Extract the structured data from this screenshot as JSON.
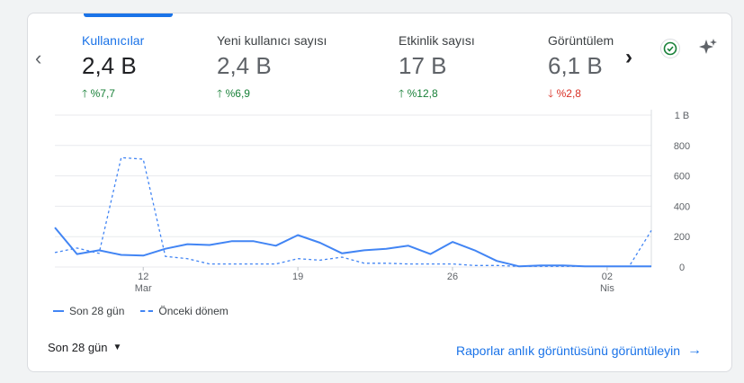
{
  "metrics": [
    {
      "label": "Kullanıcılar",
      "value": "2,4 B",
      "delta": "%7,7",
      "direction": "up",
      "active": true
    },
    {
      "label": "Yeni kullanıcı sayısı",
      "value": "2,4 B",
      "delta": "%6,9",
      "direction": "up",
      "active": false
    },
    {
      "label": "Etkinlik sayısı",
      "value": "17 B",
      "delta": "%12,8",
      "direction": "up",
      "active": false
    },
    {
      "label": "Görüntülem",
      "value": "6,1 B",
      "delta": "%2,8",
      "direction": "down",
      "active": false
    }
  ],
  "icons": {
    "prev": "chevron-left-icon",
    "next": "chevron-right-icon",
    "status": "check-circle-icon",
    "insights": "sparkle-icon"
  },
  "colors": {
    "accent": "#1a73e8",
    "series": "#4285f4",
    "up": "#188038",
    "down": "#d93025"
  },
  "chart_data": {
    "type": "line",
    "x_ticks": [
      {
        "label": "12",
        "sublabel": "Mar",
        "index": 4
      },
      {
        "label": "19",
        "sublabel": "",
        "index": 11
      },
      {
        "label": "26",
        "sublabel": "",
        "index": 18
      },
      {
        "label": "02",
        "sublabel": "Nis",
        "index": 25
      }
    ],
    "y_ticks": [
      {
        "value": 1000,
        "label": "1 B"
      },
      {
        "value": 800,
        "label": "800"
      },
      {
        "value": 600,
        "label": "600"
      },
      {
        "value": 400,
        "label": "400"
      },
      {
        "value": 200,
        "label": "200"
      },
      {
        "value": 0,
        "label": "0"
      }
    ],
    "ylim": [
      0,
      1000
    ],
    "grid": true,
    "series": [
      {
        "name": "Son 28 gün",
        "style": "solid",
        "values": [
          260,
          85,
          110,
          80,
          75,
          120,
          150,
          145,
          170,
          170,
          140,
          210,
          160,
          90,
          110,
          120,
          140,
          85,
          165,
          110,
          40,
          5,
          10,
          10,
          5,
          5,
          5,
          5
        ]
      },
      {
        "name": "Önceki dönem",
        "style": "dashed",
        "values": [
          95,
          125,
          90,
          720,
          710,
          70,
          55,
          20,
          20,
          20,
          20,
          55,
          45,
          65,
          25,
          25,
          20,
          20,
          20,
          10,
          10,
          5,
          5,
          5,
          5,
          5,
          5,
          240
        ]
      }
    ]
  },
  "footer": {
    "range_label": "Son 28 gün",
    "report_link": "Raporlar anlık görüntüsünü görüntüleyin"
  }
}
